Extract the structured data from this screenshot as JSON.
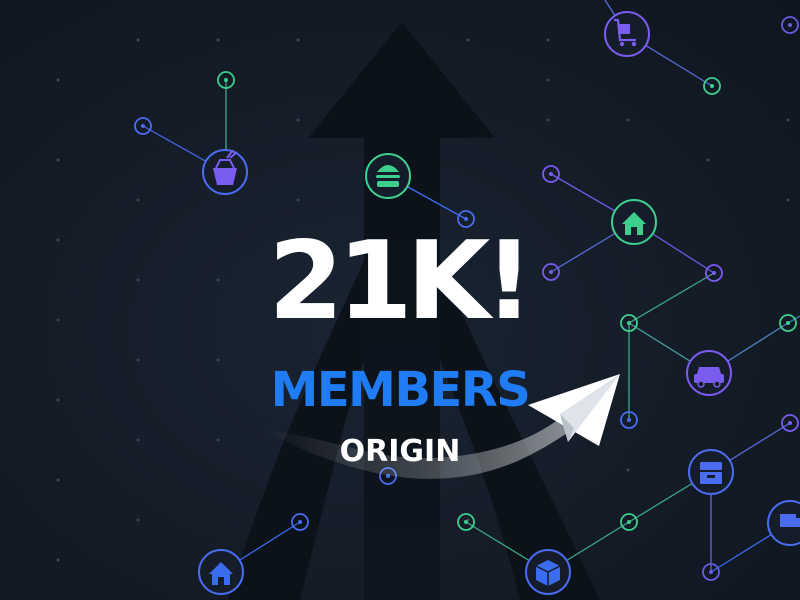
{
  "headline": "21K!",
  "subline": "MEMBERS",
  "brand": "ORIGIN",
  "colors": {
    "background": "#131b26",
    "accent_blue": "#1f7cf5",
    "node_green": "#3ecf8e",
    "node_purple": "#7b5cf0",
    "node_blue": "#3a6cf0",
    "text": "#ffffff"
  },
  "icons": [
    "shopping-cart-icon",
    "takeout-box-icon",
    "burger-icon",
    "home-icon",
    "car-icon",
    "inbox-tray-icon",
    "delivery-truck-icon",
    "package-icon",
    "home-icon",
    "paper-plane-icon",
    "upward-arrow-icon"
  ]
}
